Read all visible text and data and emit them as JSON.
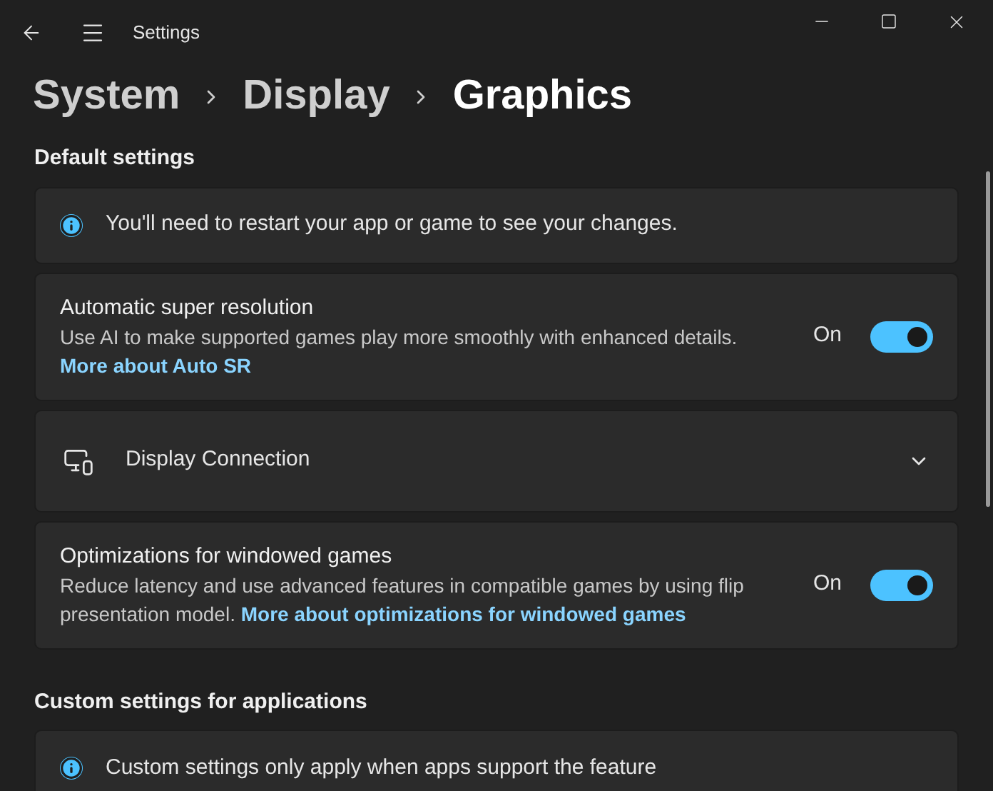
{
  "window": {
    "title": "Settings"
  },
  "breadcrumb": [
    {
      "label": "System",
      "current": false
    },
    {
      "label": "Display",
      "current": false
    },
    {
      "label": "Graphics",
      "current": true
    }
  ],
  "sections": [
    {
      "title": "Default settings",
      "cards": [
        {
          "kind": "info",
          "text": "You'll need to restart your app or game to see your changes."
        },
        {
          "kind": "toggle",
          "title": "Automatic super resolution",
          "description": "Use AI to make supported games play more smoothly with enhanced details.",
          "link": "More about Auto SR",
          "state_label": "On",
          "on": true
        },
        {
          "kind": "expander",
          "title": "Display Connection",
          "expanded": false
        },
        {
          "kind": "toggle",
          "title": "Optimizations for windowed games",
          "description": "Reduce latency and use advanced features in compatible games by using flip presentation model.",
          "link": "More about optimizations for windowed games",
          "state_label": "On",
          "on": true
        }
      ]
    },
    {
      "title": "Custom settings for applications",
      "cards": [
        {
          "kind": "info",
          "text": "Custom settings only apply when apps support the feature"
        }
      ]
    }
  ]
}
